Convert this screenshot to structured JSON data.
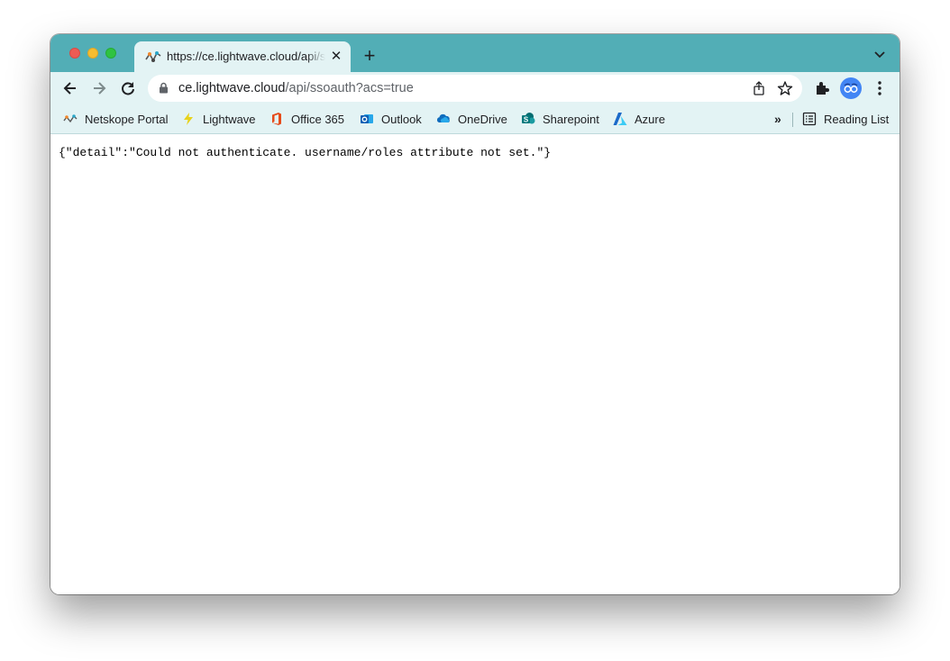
{
  "tab": {
    "title": "https://ce.lightwave.cloud/api/ssoauth?acs=true",
    "close_glyph": "✕",
    "new_tab_glyph": "+"
  },
  "omnibox": {
    "host": "ce.lightwave.cloud",
    "path": "/api/ssoauth?acs=true"
  },
  "bookmarks": {
    "items": [
      {
        "label": "Netskope Portal",
        "icon": "netskope-icon"
      },
      {
        "label": "Lightwave",
        "icon": "lightning-icon"
      },
      {
        "label": "Office 365",
        "icon": "office-icon"
      },
      {
        "label": "Outlook",
        "icon": "outlook-icon"
      },
      {
        "label": "OneDrive",
        "icon": "onedrive-icon"
      },
      {
        "label": "Sharepoint",
        "icon": "sharepoint-icon"
      },
      {
        "label": "Azure",
        "icon": "azure-icon"
      }
    ],
    "overflow_glyph": "»",
    "reading_list_label": "Reading List"
  },
  "page": {
    "body_text": "{\"detail\":\"Could not authenticate. username/roles attribute not set.\"}"
  },
  "colors": {
    "tab_strip": "#52aeb6",
    "toolbar": "#e3f3f4",
    "profile": "#4285f4"
  }
}
